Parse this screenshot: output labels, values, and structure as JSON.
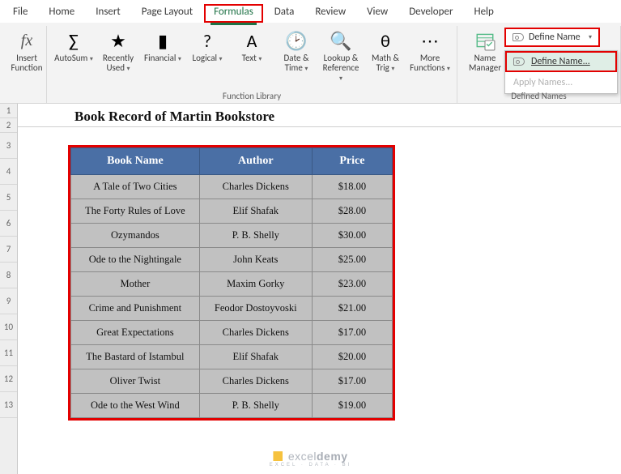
{
  "tabs": [
    "File",
    "Home",
    "Insert",
    "Page Layout",
    "Formulas",
    "Data",
    "Review",
    "View",
    "Developer",
    "Help"
  ],
  "active_tab_index": 4,
  "ribbon": {
    "insert_fn": "Insert\nFunction",
    "library_buttons": [
      {
        "label": "AutoSum",
        "icon": "∑",
        "dd": true
      },
      {
        "label": "Recently\nUsed",
        "icon": "★",
        "dd": true
      },
      {
        "label": "Financial",
        "icon": "▮",
        "dd": true
      },
      {
        "label": "Logical",
        "icon": "?",
        "dd": true
      },
      {
        "label": "Text",
        "icon": "A",
        "dd": true
      },
      {
        "label": "Date &\nTime",
        "icon": "🕑",
        "dd": true
      },
      {
        "label": "Lookup &\nReference",
        "icon": "🔍",
        "dd": true
      },
      {
        "label": "Math &\nTrig",
        "icon": "θ",
        "dd": true
      },
      {
        "label": "More\nFunctions",
        "icon": "⋯",
        "dd": true
      }
    ],
    "library_label": "Function Library",
    "name_manager": "Name\nManager",
    "define_split": "Define Name",
    "define_menu": [
      "Define Name...",
      "Apply Names..."
    ],
    "defined_label": "Defined Names"
  },
  "sheet": {
    "title": "Book Record of Martin Bookstore",
    "row_headers": [
      "1",
      "2",
      "3",
      "4",
      "5",
      "6",
      "7",
      "8",
      "9",
      "10",
      "11",
      "12",
      "13"
    ],
    "columns": [
      "Book Name",
      "Author",
      "Price"
    ],
    "rows": [
      [
        "A Tale of Two Cities",
        "Charles Dickens",
        "$18.00"
      ],
      [
        "The Forty Rules of Love",
        "Elif Shafak",
        "$28.00"
      ],
      [
        "Ozymandos",
        "P. B. Shelly",
        "$30.00"
      ],
      [
        "Ode to the Nightingale",
        "John Keats",
        "$25.00"
      ],
      [
        "Mother",
        "Maxim Gorky",
        "$23.00"
      ],
      [
        "Crime and Punishment",
        "Feodor Dostoyvoski",
        "$21.00"
      ],
      [
        "Great Expectations",
        "Charles Dickens",
        "$17.00"
      ],
      [
        "The Bastard of Istambul",
        "Elif Shafak",
        "$20.00"
      ],
      [
        "Oliver Twist",
        "Charles Dickens",
        "$17.00"
      ],
      [
        "Ode to the West Wind",
        "P. B. Shelly",
        "$19.00"
      ]
    ]
  },
  "footer": {
    "brand_a": "excel",
    "brand_b": "demy",
    "sub": "EXCEL · DATA · BI"
  }
}
